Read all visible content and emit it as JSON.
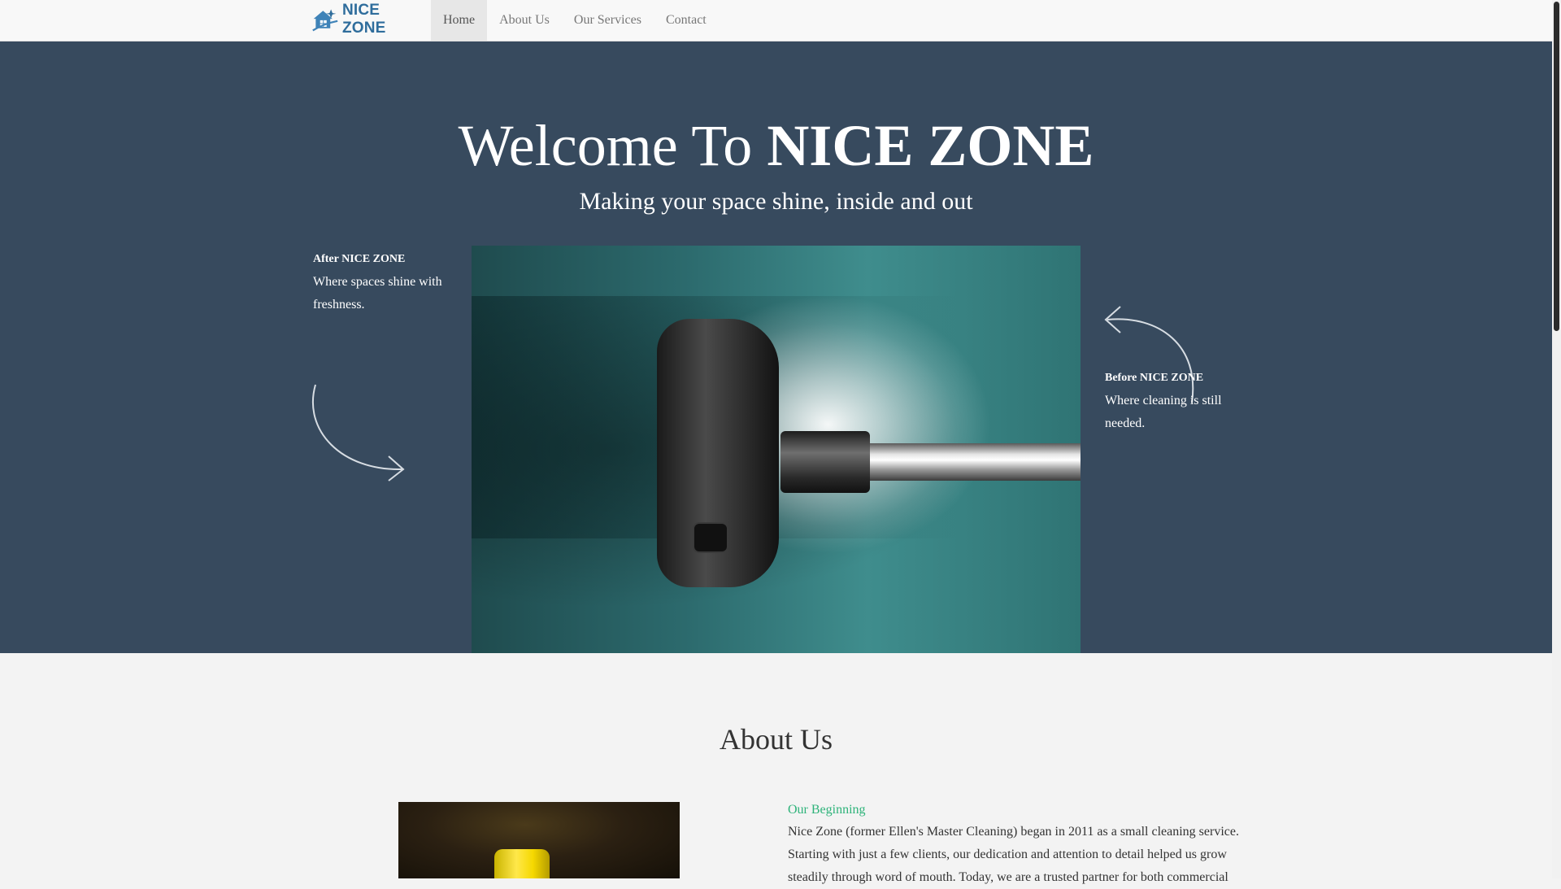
{
  "nav": {
    "logo_text": "NICE ZONE",
    "items": [
      {
        "label": "Home",
        "active": true
      },
      {
        "label": "About Us",
        "active": false
      },
      {
        "label": "Our Services",
        "active": false
      },
      {
        "label": "Contact",
        "active": false
      }
    ]
  },
  "hero": {
    "title_prefix": "Welcome To",
    "title_brand": "NICE ZONE",
    "subtitle": "Making your space shine, inside and out",
    "after": {
      "heading": "After NICE ZONE",
      "text": "Where spaces shine with freshness."
    },
    "before": {
      "heading": "Before NICE ZONE",
      "text": "Where cleaning is still needed."
    }
  },
  "about": {
    "title": "About Us",
    "subheading": "Our Beginning",
    "text": "Nice Zone (former Ellen's Master Cleaning) began in 2011 as a small cleaning service. Starting with just a few clients, our dedication and attention to detail helped us grow steadily through word of mouth. Today, we are a trusted partner for both commercial"
  },
  "colors": {
    "hero_bg": "#374a5e",
    "accent_green": "#2eb37a",
    "logo_blue": "#2f6d9c"
  },
  "icons": {
    "logo": "house-sparkle-icon",
    "after_arrow": "curved-arrow-right-icon",
    "before_arrow": "curved-arrow-left-icon"
  }
}
